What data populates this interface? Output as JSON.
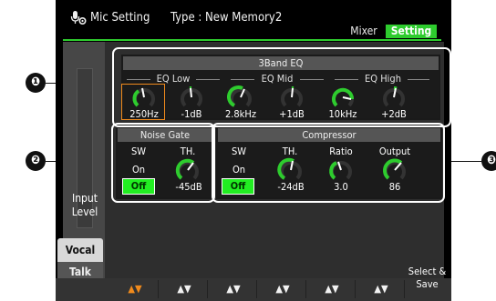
{
  "titlebar": {
    "title": "Mic Setting",
    "type_label": "Type : New Memory2"
  },
  "tabs": {
    "mixer": "Mixer",
    "setting": "Setting"
  },
  "left": {
    "input_level": "Input\nLevel",
    "vocal": "Vocal",
    "talk": "Talk"
  },
  "eq": {
    "title": "3Band EQ",
    "low_label": "EQ Low",
    "mid_label": "EQ Mid",
    "high_label": "EQ High",
    "knobs": [
      {
        "value": "250Hz"
      },
      {
        "value": "-1dB"
      },
      {
        "value": "2.8kHz"
      },
      {
        "value": "+1dB"
      },
      {
        "value": "10kHz"
      },
      {
        "value": "+2dB"
      }
    ]
  },
  "noise_gate": {
    "title": "Noise Gate",
    "sw_label": "SW",
    "th_label": "TH.",
    "on": "On",
    "off": "Off",
    "th_value": "-45dB"
  },
  "compressor": {
    "title": "Compressor",
    "sw_label": "SW",
    "th_label": "TH.",
    "ratio_label": "Ratio",
    "output_label": "Output",
    "on": "On",
    "off": "Off",
    "th_value": "-24dB",
    "ratio_value": "3.0",
    "output_value": "86"
  },
  "bottom": {
    "buttons": [
      "▲▼",
      "▲▼",
      "▲▼",
      "▲▼",
      "▲▼",
      "▲▼"
    ],
    "select_save": "Select &\nSave"
  },
  "callouts": [
    "❶",
    "❷",
    "❸"
  ],
  "colors": {
    "accent": "#2ecc2e",
    "orange": "#f08a1c"
  }
}
